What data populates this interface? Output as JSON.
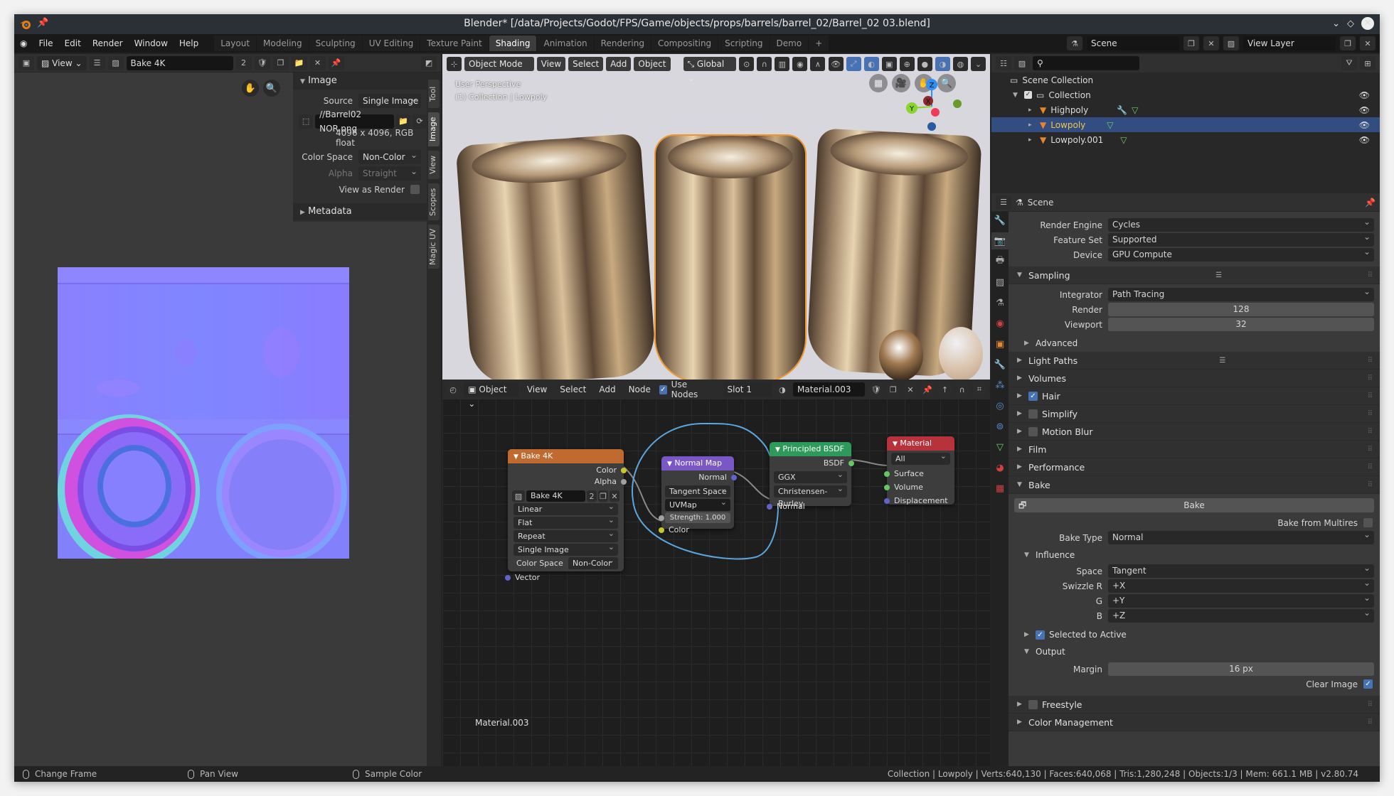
{
  "window": {
    "title": "Blender* [/data/Projects/Godot/FPS/Game/objects/props/barrels/barrel_02/Barrel_02 03.blend]"
  },
  "menu": {
    "items": [
      "File",
      "Edit",
      "Render",
      "Window",
      "Help"
    ],
    "workspaces": [
      "Layout",
      "Modeling",
      "Sculpting",
      "UV Editing",
      "Texture Paint",
      "Shading",
      "Animation",
      "Rendering",
      "Compositing",
      "Scripting",
      "Demo"
    ],
    "active_workspace": "Shading",
    "add_tab": "+",
    "scene": "Scene",
    "view_layer": "View Layer"
  },
  "image_editor": {
    "view_label": "View",
    "image_name": "Bake 4K",
    "users": "2",
    "panel_image": {
      "title": "Image",
      "source_label": "Source",
      "source_value": "Single Image",
      "filepath": "//Barrel02 NOR.png",
      "info": "4096 x 4096,  RGB float",
      "color_space_label": "Color Space",
      "color_space_value": "Non-Color",
      "alpha_label": "Alpha",
      "alpha_value": "Straight",
      "view_as_render_label": "View as Render",
      "view_as_render": false
    },
    "panel_metadata": {
      "title": "Metadata"
    },
    "side_tabs": [
      "Tool",
      "Image",
      "View",
      "Scopes",
      "Magic UV"
    ],
    "active_side_tab": "Image"
  },
  "viewport": {
    "mode": "Object Mode",
    "menus": [
      "View",
      "Select",
      "Add",
      "Object"
    ],
    "orientation": "Global",
    "overlay_line1": "User Perspective",
    "overlay_line2": "(1) Collection | Lowpoly",
    "gizmo": {
      "x": "X",
      "y": "Y",
      "z": "Z"
    }
  },
  "node_editor": {
    "type": "Object",
    "menus": [
      "View",
      "Select",
      "Add",
      "Node"
    ],
    "use_nodes_label": "Use Nodes",
    "use_nodes": true,
    "slot": "Slot 1",
    "material": "Material.003",
    "material_label": "Material.003",
    "nodes": {
      "image_texture": {
        "title": "Bake 4K",
        "outputs": [
          "Color",
          "Alpha"
        ],
        "image": "Bake 4K",
        "users": "2",
        "interpolation": "Linear",
        "projection": "Flat",
        "extension": "Repeat",
        "source": "Single Image",
        "color_space_label": "Color Space",
        "color_space": "Non-Color",
        "input": "Vector",
        "header_color": "#c06a2f"
      },
      "normal_map": {
        "title": "Normal Map",
        "output": "Normal",
        "space": "Tangent Space",
        "uv_map": "UVMap",
        "strength_label": "Strength:",
        "strength": "1.000",
        "input": "Color",
        "header_color": "#7a57c7"
      },
      "principled": {
        "title": "Principled BSDF",
        "output": "BSDF",
        "distribution": "GGX",
        "subsurface": "Christensen-Burley",
        "input": "Normal",
        "header_color": "#2e9a5a"
      },
      "material_output": {
        "title": "Material Output",
        "target": "All",
        "inputs": [
          "Surface",
          "Volume",
          "Displacement"
        ],
        "header_color": "#b8323c"
      }
    }
  },
  "outliner": {
    "root": "Scene Collection",
    "items": [
      {
        "name": "Collection",
        "level": 1
      },
      {
        "name": "Highpoly",
        "level": 2
      },
      {
        "name": "Lowpoly",
        "level": 2,
        "selected": true
      },
      {
        "name": "Lowpoly.001",
        "level": 2
      }
    ]
  },
  "properties": {
    "context": "Scene",
    "render_engine_label": "Render Engine",
    "render_engine": "Cycles",
    "feature_set_label": "Feature Set",
    "feature_set": "Supported",
    "device_label": "Device",
    "device": "GPU Compute",
    "sampling": {
      "title": "Sampling",
      "integrator_label": "Integrator",
      "integrator": "Path Tracing",
      "render_label": "Render",
      "render": "128",
      "viewport_label": "Viewport",
      "viewport": "32",
      "advanced": "Advanced"
    },
    "sections": [
      {
        "title": "Light Paths"
      },
      {
        "title": "Volumes"
      },
      {
        "title": "Hair",
        "checkbox": true
      },
      {
        "title": "Simplify",
        "checkbox": false
      },
      {
        "title": "Motion Blur",
        "checkbox": false
      },
      {
        "title": "Film"
      },
      {
        "title": "Performance"
      }
    ],
    "bake": {
      "title": "Bake",
      "button": "Bake",
      "from_multires_label": "Bake from Multires",
      "from_multires": false,
      "type_label": "Bake Type",
      "type": "Normal",
      "influence": "Influence",
      "space_label": "Space",
      "space": "Tangent",
      "swizzle_r_label": "Swizzle R",
      "swizzle_r": "+X",
      "g_label": "G",
      "g": "+Y",
      "b_label": "B",
      "b": "+Z",
      "selected_to_active_label": "Selected to Active",
      "selected_to_active": true,
      "output": "Output",
      "margin_label": "Margin",
      "margin": "16 px",
      "clear_image_label": "Clear Image",
      "clear_image": true
    },
    "after": [
      {
        "title": "Freestyle",
        "checkbox": false
      },
      {
        "title": "Color Management"
      }
    ]
  },
  "statusbar": {
    "hints": [
      "Change Frame",
      "Pan View",
      "Sample Color"
    ],
    "stats": "Collection | Lowpoly | Verts:640,130 | Faces:640,068 | Tris:1,280,248 | Objects:1/3 | Mem: 661.1 MB | v2.80.74"
  }
}
